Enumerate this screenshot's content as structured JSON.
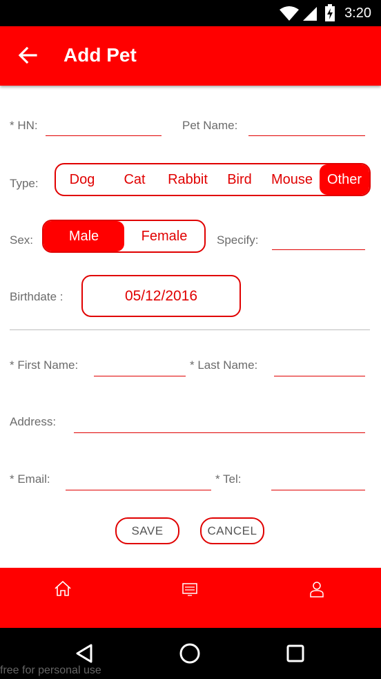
{
  "status_bar": {
    "time": "3:20"
  },
  "app_bar": {
    "title": "Add Pet"
  },
  "form": {
    "hn_label": "* HN:",
    "pet_name_label": "Pet Name:",
    "type_label": "Type:",
    "type_options": [
      "Dog",
      "Cat",
      "Rabbit",
      "Bird",
      "Mouse",
      "Other"
    ],
    "type_selected": "Other",
    "sex_label": "Sex:",
    "sex_options": [
      "Male",
      "Female"
    ],
    "sex_selected": "Male",
    "specify_label": "Specify:",
    "birthdate_label": "Birthdate :",
    "birthdate_value": "05/12/2016",
    "first_name_label": "* First Name:",
    "last_name_label": "* Last Name:",
    "address_label": "Address:",
    "email_label": "* Email:",
    "tel_label": "* Tel:",
    "save_label": "SAVE",
    "cancel_label": "CANCEL"
  },
  "bottom_nav": {
    "items": [
      "home-icon",
      "list-icon",
      "profile-icon"
    ]
  },
  "watermark": "free for personal use",
  "colors": {
    "accent": "#ff0000",
    "status_bar": "#000000"
  }
}
